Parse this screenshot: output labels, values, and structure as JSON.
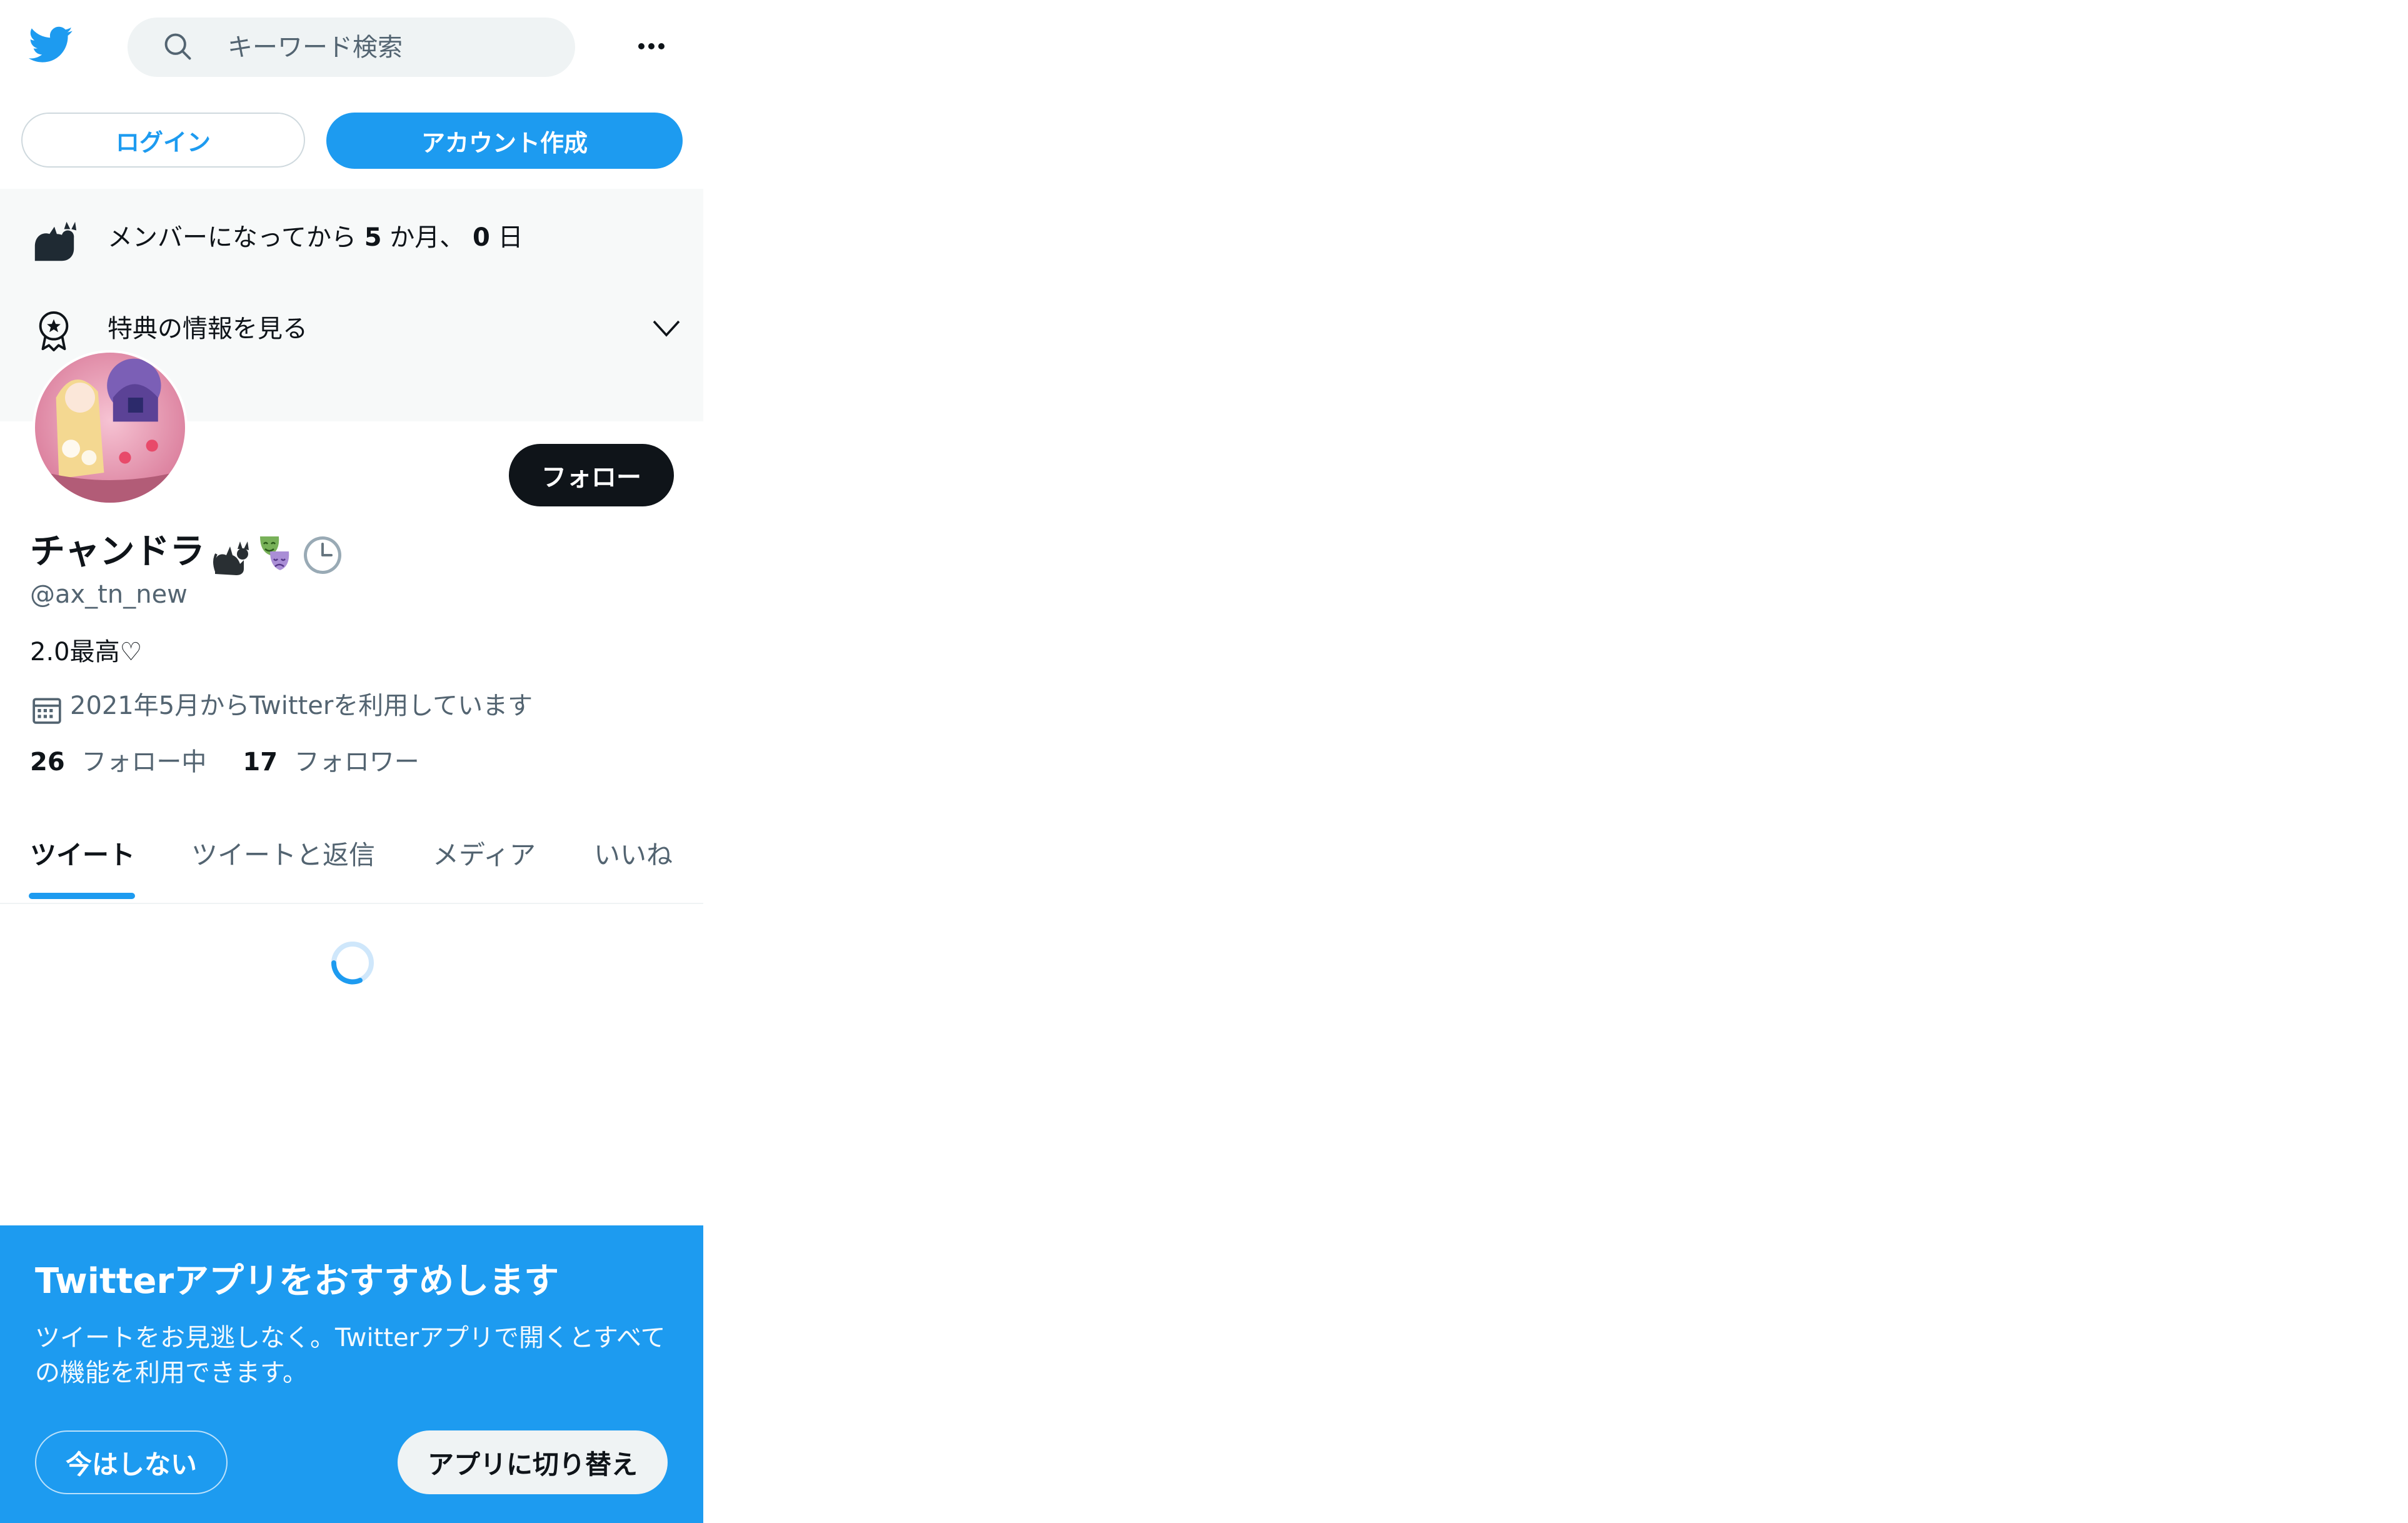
{
  "header": {
    "search_placeholder": "キーワード検索",
    "icons": {
      "logo": "twitter-bird",
      "search": "magnifier",
      "more": "ellipsis"
    }
  },
  "auth": {
    "login_label": "ログイン",
    "signup_label": "アカウント作成"
  },
  "membership": {
    "prefix": "メンバーになってから",
    "months": "5",
    "months_unit": "か月、",
    "days": "0",
    "days_unit": "日",
    "perks_label": "特典の情報を見る"
  },
  "profile": {
    "display_name": "チャンドラ",
    "handle": "@ax_tn_new",
    "bio": "2.0最高♡",
    "joined": "2021年5月からTwitterを利用しています",
    "follow_label": "フォロー",
    "following_count": "26",
    "following_label": "フォロー中",
    "followers_count": "17",
    "followers_label": "フォロワー"
  },
  "tabs": [
    {
      "label": "ツイート",
      "active": true
    },
    {
      "label": "ツイートと返信",
      "active": false
    },
    {
      "label": "メディア",
      "active": false
    },
    {
      "label": "いいね",
      "active": false
    }
  ],
  "app_banner": {
    "title": "Twitterアプリをおすすめします",
    "body": "ツイートをお見逃しなく。Twitterアプリで開くとすべての機能を利用できます。",
    "not_now_label": "今はしない",
    "switch_label": "アプリに切り替え"
  },
  "colors": {
    "accent": "#1d9bf0",
    "text": "#0f1419",
    "muted": "#536471",
    "panel": "#f7f9f9"
  }
}
